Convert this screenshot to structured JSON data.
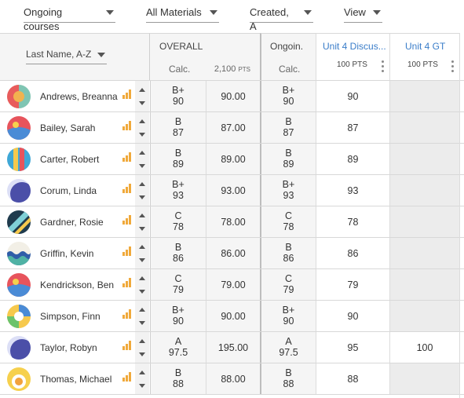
{
  "filters": [
    {
      "label": "Ongoing courses"
    },
    {
      "label": "All Materials"
    },
    {
      "label": "Created, A"
    },
    {
      "label": "View"
    }
  ],
  "header": {
    "sort_label": "Last Name, A-Z",
    "overall_title": "OVERALL",
    "overall_calc": "Calc.",
    "overall_pts_num": "2,100",
    "overall_pts_unit": "PTS",
    "ongoing_title": "Ongoin.",
    "ongoing_calc": "Calc.",
    "assignments": [
      {
        "title": "Unit 4 Discus...",
        "pts": "100 PTS"
      },
      {
        "title": "Unit 4 GT",
        "pts": "100 PTS"
      }
    ]
  },
  "students": [
    {
      "name": "Andrews, Breanna",
      "overall_letter": "B+",
      "overall_pct": "90",
      "overall_score": "90.00",
      "ongoing_letter": "B+",
      "ongoing_pct": "90",
      "unit4_discussion": "90",
      "unit4_gt": ""
    },
    {
      "name": "Bailey, Sarah",
      "overall_letter": "B",
      "overall_pct": "87",
      "overall_score": "87.00",
      "ongoing_letter": "B",
      "ongoing_pct": "87",
      "unit4_discussion": "87",
      "unit4_gt": ""
    },
    {
      "name": "Carter, Robert",
      "overall_letter": "B",
      "overall_pct": "89",
      "overall_score": "89.00",
      "ongoing_letter": "B",
      "ongoing_pct": "89",
      "unit4_discussion": "89",
      "unit4_gt": ""
    },
    {
      "name": "Corum, Linda",
      "overall_letter": "B+",
      "overall_pct": "93",
      "overall_score": "93.00",
      "ongoing_letter": "B+",
      "ongoing_pct": "93",
      "unit4_discussion": "93",
      "unit4_gt": ""
    },
    {
      "name": "Gardner, Rosie",
      "overall_letter": "C",
      "overall_pct": "78",
      "overall_score": "78.00",
      "ongoing_letter": "C",
      "ongoing_pct": "78",
      "unit4_discussion": "78",
      "unit4_gt": ""
    },
    {
      "name": "Griffin, Kevin",
      "overall_letter": "B",
      "overall_pct": "86",
      "overall_score": "86.00",
      "ongoing_letter": "B",
      "ongoing_pct": "86",
      "unit4_discussion": "86",
      "unit4_gt": ""
    },
    {
      "name": "Kendrickson, Ben",
      "overall_letter": "C",
      "overall_pct": "79",
      "overall_score": "79.00",
      "ongoing_letter": "C",
      "ongoing_pct": "79",
      "unit4_discussion": "79",
      "unit4_gt": ""
    },
    {
      "name": "Simpson, Finn",
      "overall_letter": "B+",
      "overall_pct": "90",
      "overall_score": "90.00",
      "ongoing_letter": "B+",
      "ongoing_pct": "90",
      "unit4_discussion": "90",
      "unit4_gt": ""
    },
    {
      "name": "Taylor, Robyn",
      "overall_letter": "A",
      "overall_pct": "97.5",
      "overall_score": "195.00",
      "ongoing_letter": "A",
      "ongoing_pct": "97.5",
      "unit4_discussion": "95",
      "unit4_gt": "100"
    },
    {
      "name": "Thomas, Michael",
      "overall_letter": "B",
      "overall_pct": "88",
      "overall_score": "88.00",
      "ongoing_letter": "B",
      "ongoing_pct": "88",
      "unit4_discussion": "88",
      "unit4_gt": ""
    }
  ],
  "colors": {
    "accent_link": "#3a7dc9",
    "grade_bg": "#f5f5f5",
    "empty_cell": "#ececec",
    "chart_icon": "#f0a93b"
  },
  "icons": {
    "row_chart": "bar-chart-icon",
    "sort_caret": "chevron-down-icon",
    "column_menu": "more-vertical-icon"
  }
}
